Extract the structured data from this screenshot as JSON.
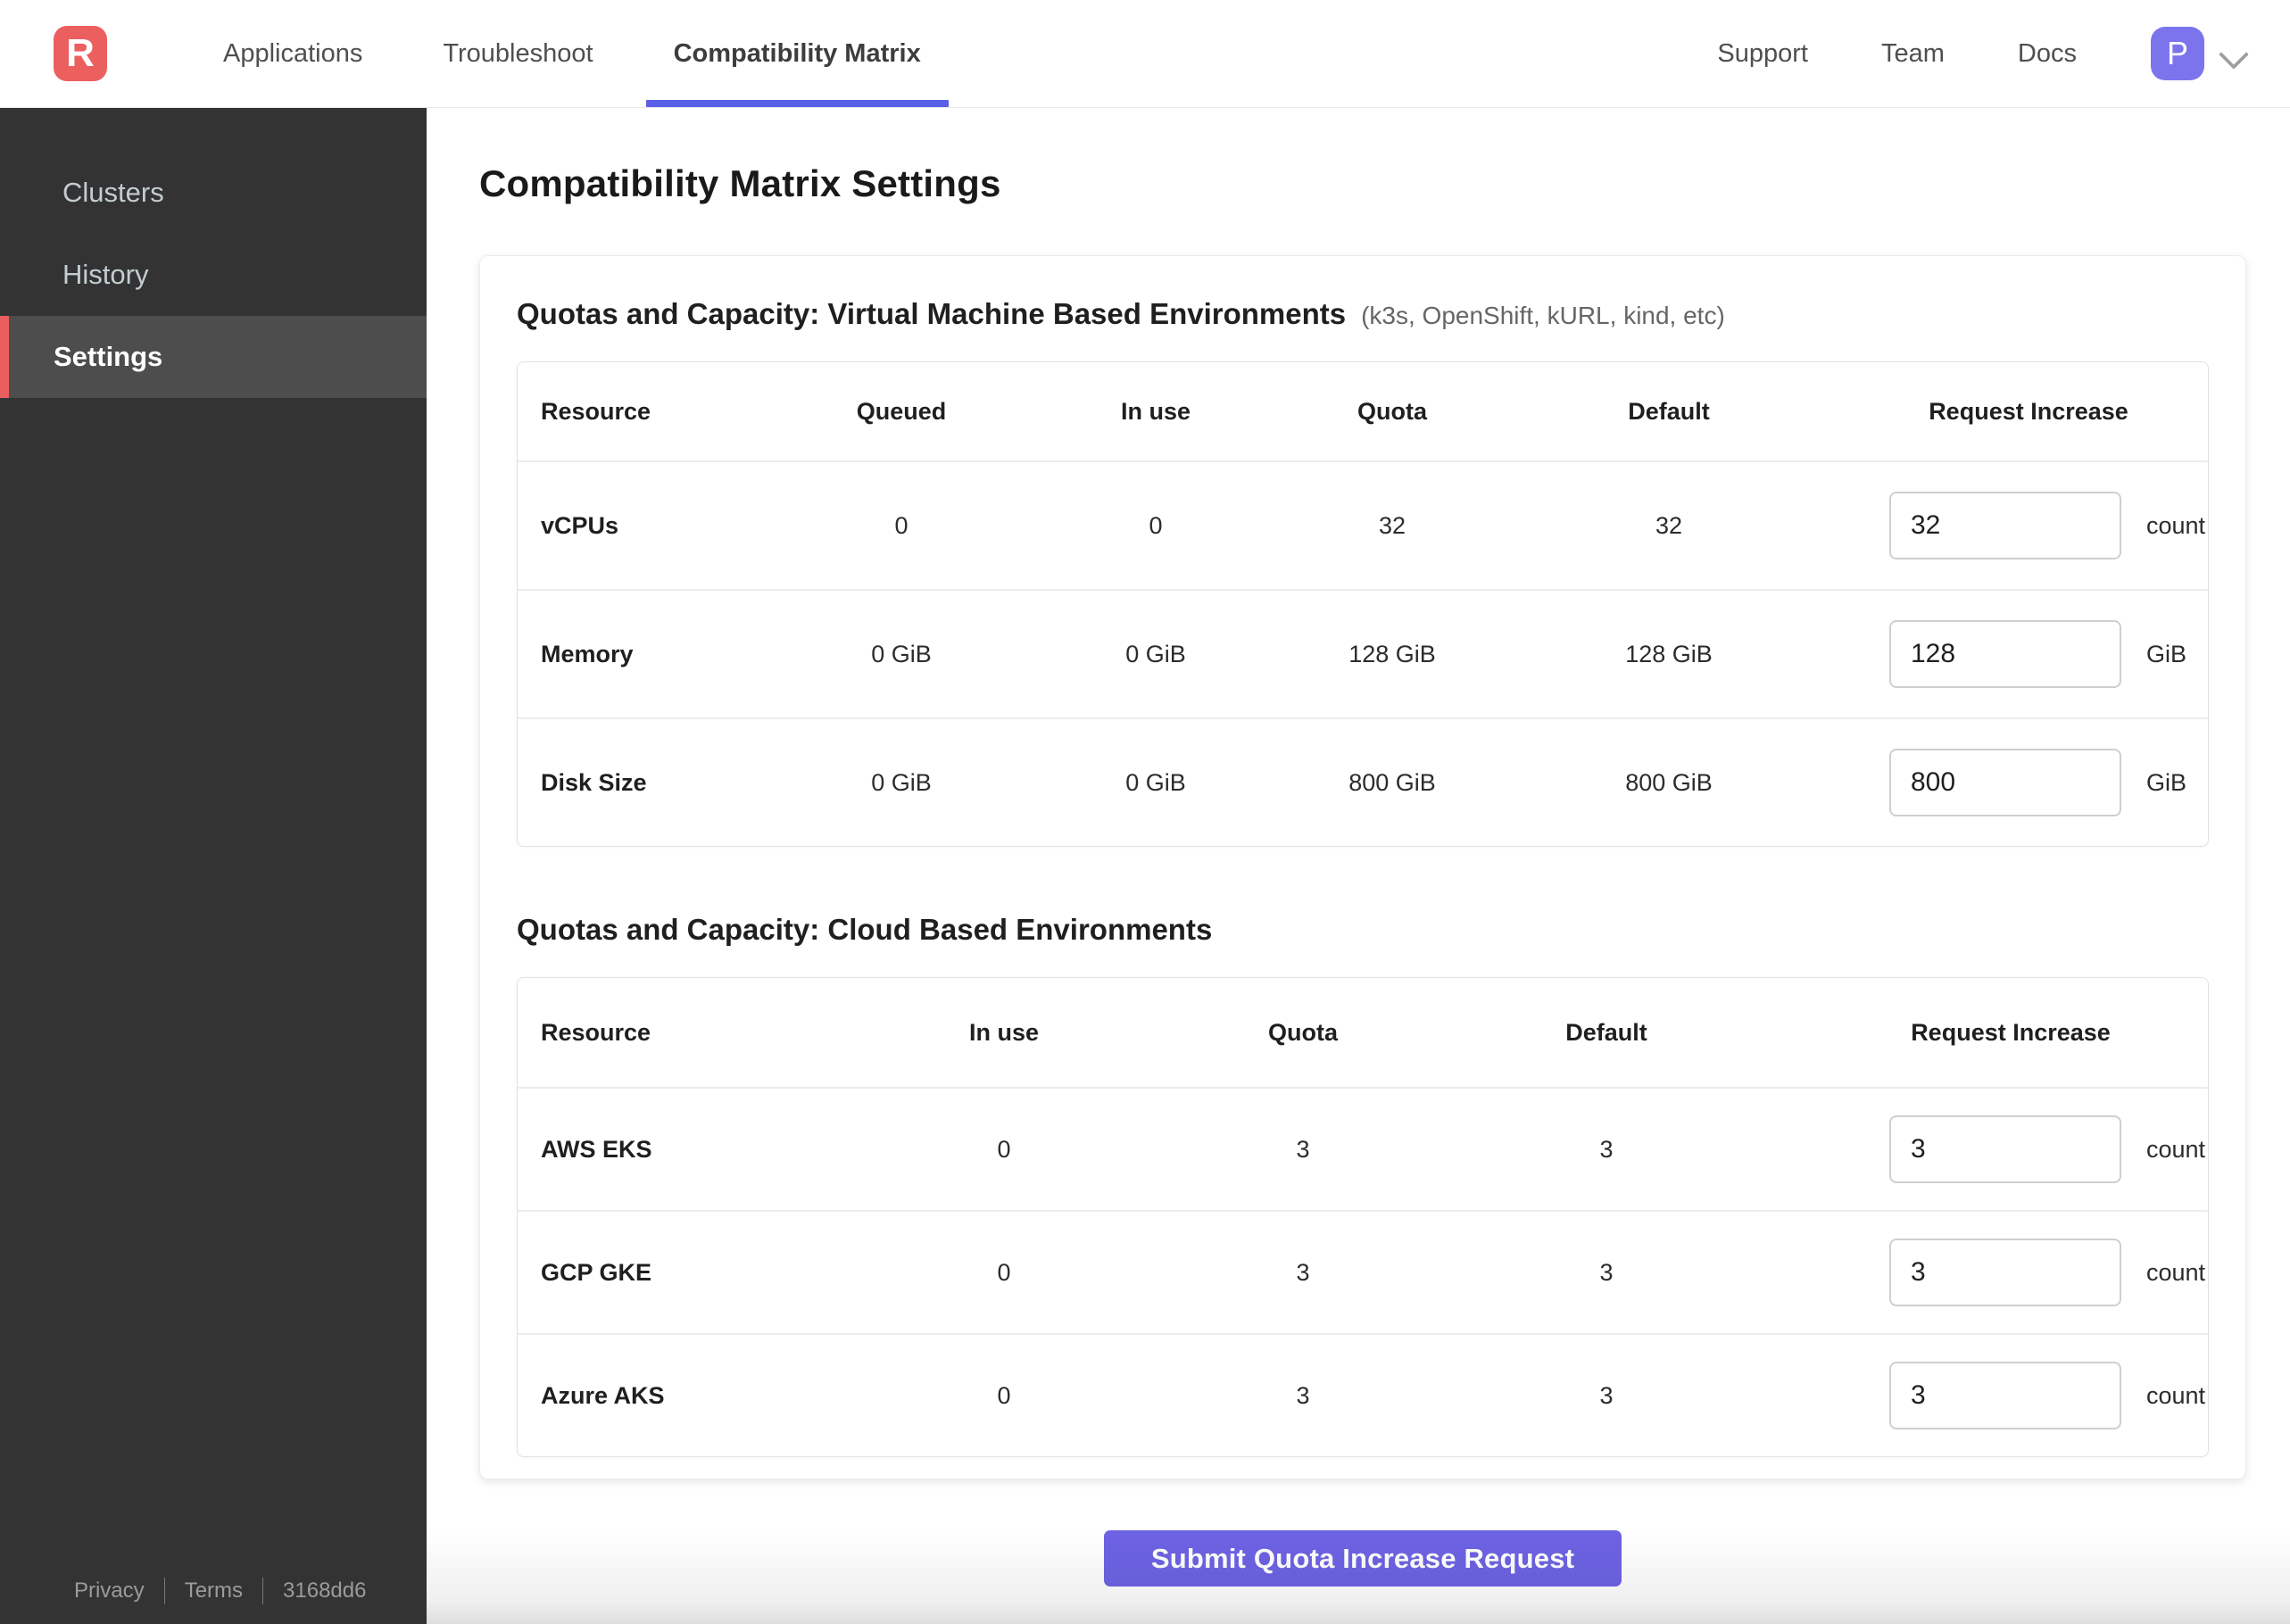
{
  "colors": {
    "brand_red": "#ec5f5f",
    "indigo_accent": "#5a5fe8",
    "indigo_button": "#6d63e4",
    "avatar_bg": "#7b74ec",
    "sidebar_bg": "#333333",
    "sidebar_active_bg": "#4d4d4d"
  },
  "header": {
    "logo_letter": "R",
    "nav": [
      {
        "label": "Applications"
      },
      {
        "label": "Troubleshoot"
      },
      {
        "label": "Compatibility Matrix"
      }
    ],
    "right_nav": [
      {
        "label": "Support"
      },
      {
        "label": "Team"
      },
      {
        "label": "Docs"
      }
    ],
    "avatar_initial": "P"
  },
  "sidebar": {
    "items": [
      {
        "label": "Clusters"
      },
      {
        "label": "History"
      },
      {
        "label": "Settings"
      }
    ],
    "footer": {
      "privacy": "Privacy",
      "terms": "Terms",
      "build": "3168dd6"
    }
  },
  "main": {
    "title": "Compatibility Matrix Settings",
    "vm_section": {
      "heading": "Quotas and Capacity: Virtual Machine Based Environments",
      "heading_note": "(k3s, OpenShift, kURL, kind, etc)",
      "columns": [
        "Resource",
        "Queued",
        "In use",
        "Quota",
        "Default",
        "Request Increase"
      ],
      "rows": [
        {
          "resource": "vCPUs",
          "queued": "0",
          "in_use": "0",
          "quota": "32",
          "default": "32",
          "input_value": "32",
          "unit": "count"
        },
        {
          "resource": "Memory",
          "queued": "0 GiB",
          "in_use": "0 GiB",
          "quota": "128 GiB",
          "default": "128 GiB",
          "input_value": "128",
          "unit": "GiB"
        },
        {
          "resource": "Disk Size",
          "queued": "0 GiB",
          "in_use": "0 GiB",
          "quota": "800 GiB",
          "default": "800 GiB",
          "input_value": "800",
          "unit": "GiB"
        }
      ]
    },
    "cloud_section": {
      "heading": "Quotas and Capacity: Cloud Based Environments",
      "columns": [
        "Resource",
        "In use",
        "Quota",
        "Default",
        "Request Increase"
      ],
      "rows": [
        {
          "resource": "AWS EKS",
          "in_use": "0",
          "quota": "3",
          "default": "3",
          "input_value": "3",
          "unit": "count"
        },
        {
          "resource": "GCP GKE",
          "in_use": "0",
          "quota": "3",
          "default": "3",
          "input_value": "3",
          "unit": "count"
        },
        {
          "resource": "Azure AKS",
          "in_use": "0",
          "quota": "3",
          "default": "3",
          "input_value": "3",
          "unit": "count"
        }
      ]
    },
    "submit_button": "Submit Quota Increase Request"
  }
}
